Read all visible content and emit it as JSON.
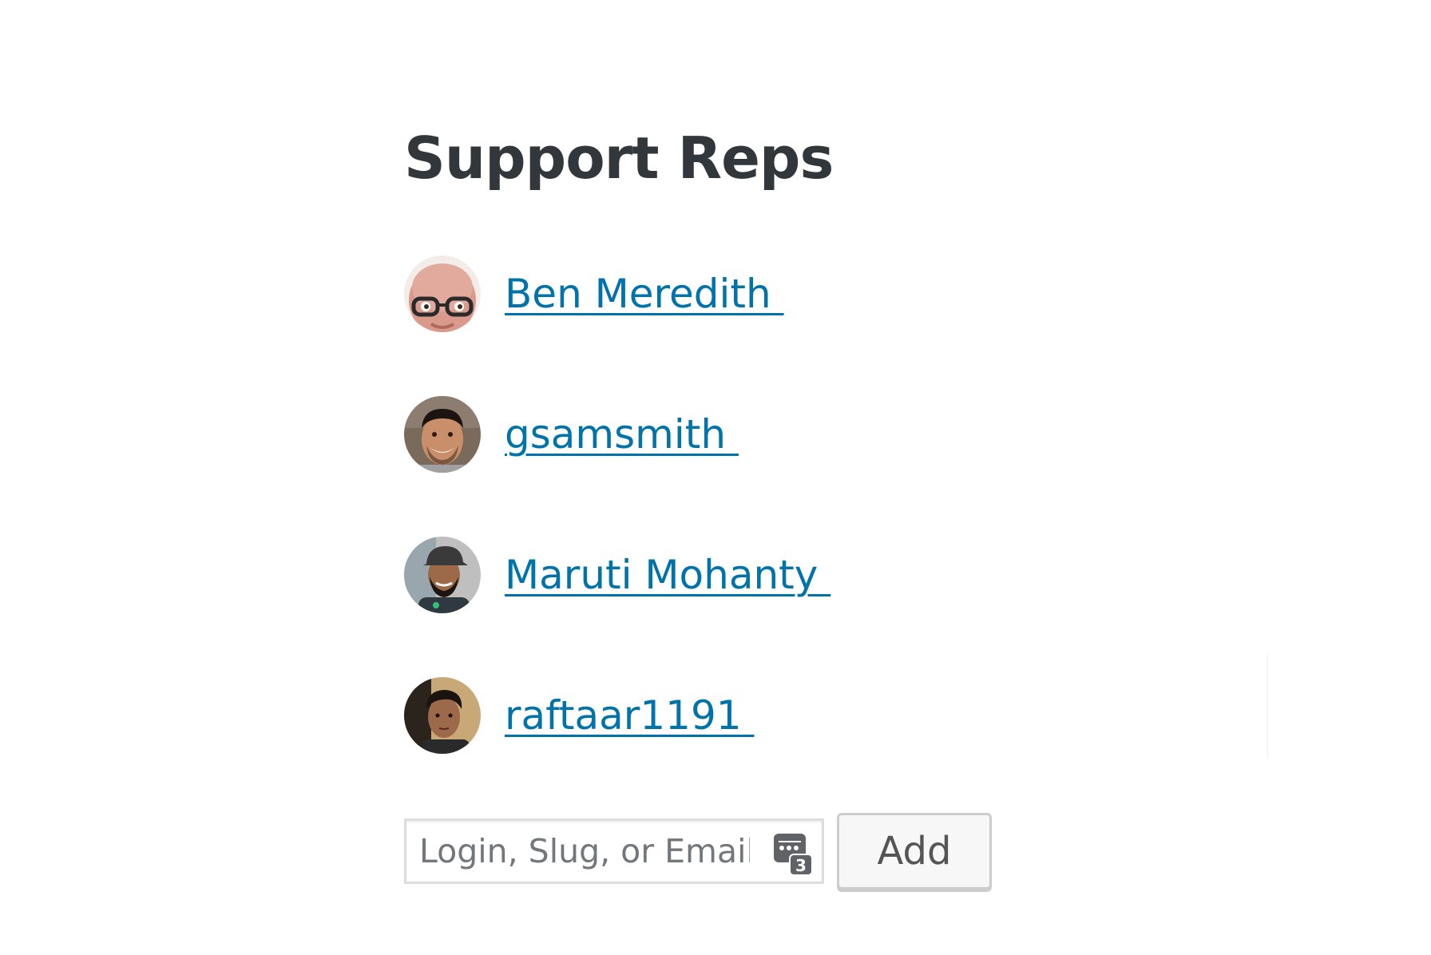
{
  "title": "Support Reps",
  "reps": [
    {
      "name": "Ben Meredith ",
      "avatar_icon": "bald-man-glasses-avatar"
    },
    {
      "name": "gsamsmith ",
      "avatar_icon": "smiling-man-avatar"
    },
    {
      "name": "Maruti Mohanty ",
      "avatar_icon": "man-with-cap-avatar"
    },
    {
      "name": "raftaar1191 ",
      "avatar_icon": "young-man-avatar"
    }
  ],
  "add_form": {
    "placeholder": "Login, Slug, or Email.",
    "password_icon_badge": "3",
    "button_label": "Add"
  },
  "colors": {
    "link": "#0073aa",
    "title": "#32373c"
  }
}
